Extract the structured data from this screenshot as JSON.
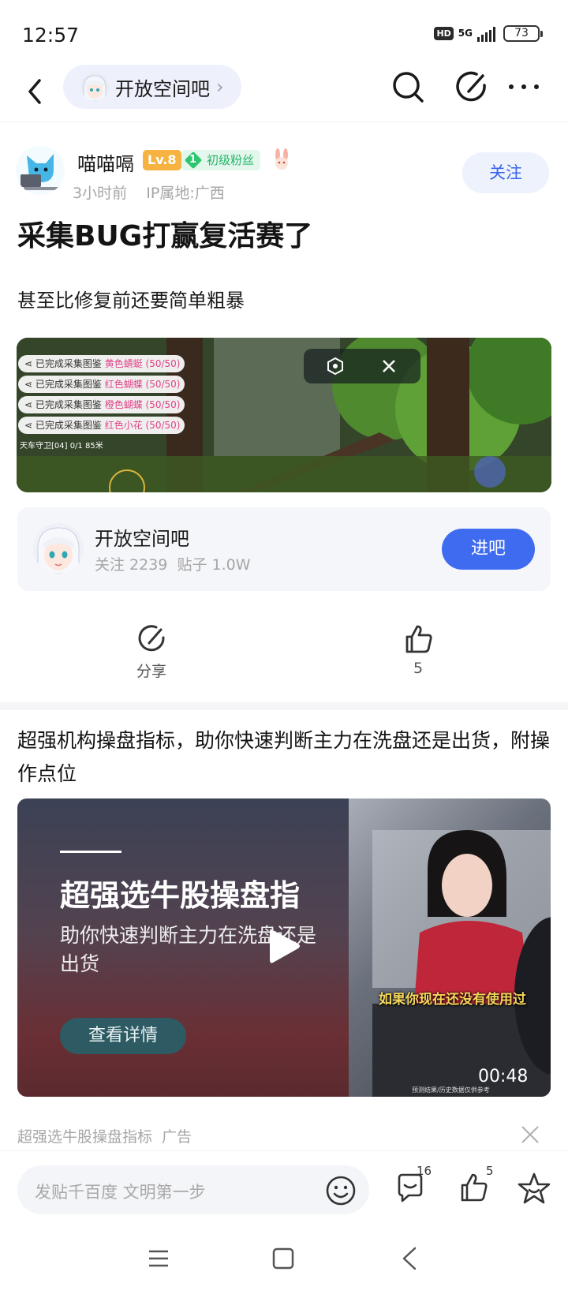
{
  "status_bar": {
    "time": "12:57",
    "hd": "HD",
    "network": "5G",
    "battery": "73"
  },
  "nav": {
    "forum_name": "开放空间吧",
    "chevron": "›"
  },
  "post": {
    "author": "喵喵嗝",
    "level": "Lv.8",
    "fan_level": "1",
    "fan_label": "初级粉丝",
    "time_ago": "3小时前",
    "ip_location": "IP属地:广西",
    "follow_label": "关注",
    "title": "采集BUG打赢复活赛了",
    "body": "甚至比修复前还要简单粗暴",
    "image": {
      "achievements": [
        {
          "prefix": "已完成采集图鉴",
          "item": "黄色蜻蜓 (50/50)"
        },
        {
          "prefix": "已完成采集图鉴",
          "item": "红色蝴蝶 (50/50)"
        },
        {
          "prefix": "已完成采集图鉴",
          "item": "橙色蝴蝶 (50/50)"
        },
        {
          "prefix": "已完成采集图鉴",
          "item": "红色小花 (50/50)"
        }
      ],
      "hud_text": "天车守卫[04]   0/1   85米"
    }
  },
  "forum_card": {
    "name": "开放空间吧",
    "follow_count": "关注 2239",
    "post_count": "贴子 1.0W",
    "enter_label": "进吧"
  },
  "actions": {
    "share_label": "分享",
    "like_count": "5"
  },
  "ad": {
    "title": "超强机构操盘指标，助你快速判断主力在洗盘还是出货，附操作点位",
    "headline": "超强选牛股操盘指",
    "subline": "助你快速判断主力在洗盘还是出货",
    "detail_button": "查看详情",
    "caption": "如果你现在还没有使用过",
    "disclaimer": "预测结果/历史数据仅供参考",
    "duration": "00:48",
    "footer_source": "超强选牛股操盘指标",
    "footer_tag": "广告"
  },
  "bottom_bar": {
    "reply_placeholder": "发贴千百度 文明第一步",
    "comment_count": "16",
    "like_count": "5"
  },
  "colors": {
    "accent_blue": "#3f6bf1",
    "follow_text": "#3a64ea",
    "level_badge": "#f7b341",
    "fan_badge": "#27b56a"
  },
  "icons": [
    "back-icon",
    "search-icon",
    "share-icon",
    "more-icon",
    "bunny-icon",
    "like-icon",
    "play-icon",
    "close-icon",
    "emoji-icon",
    "comment-icon",
    "star-icon",
    "menu-icon",
    "home-icon",
    "back-nav-icon"
  ]
}
